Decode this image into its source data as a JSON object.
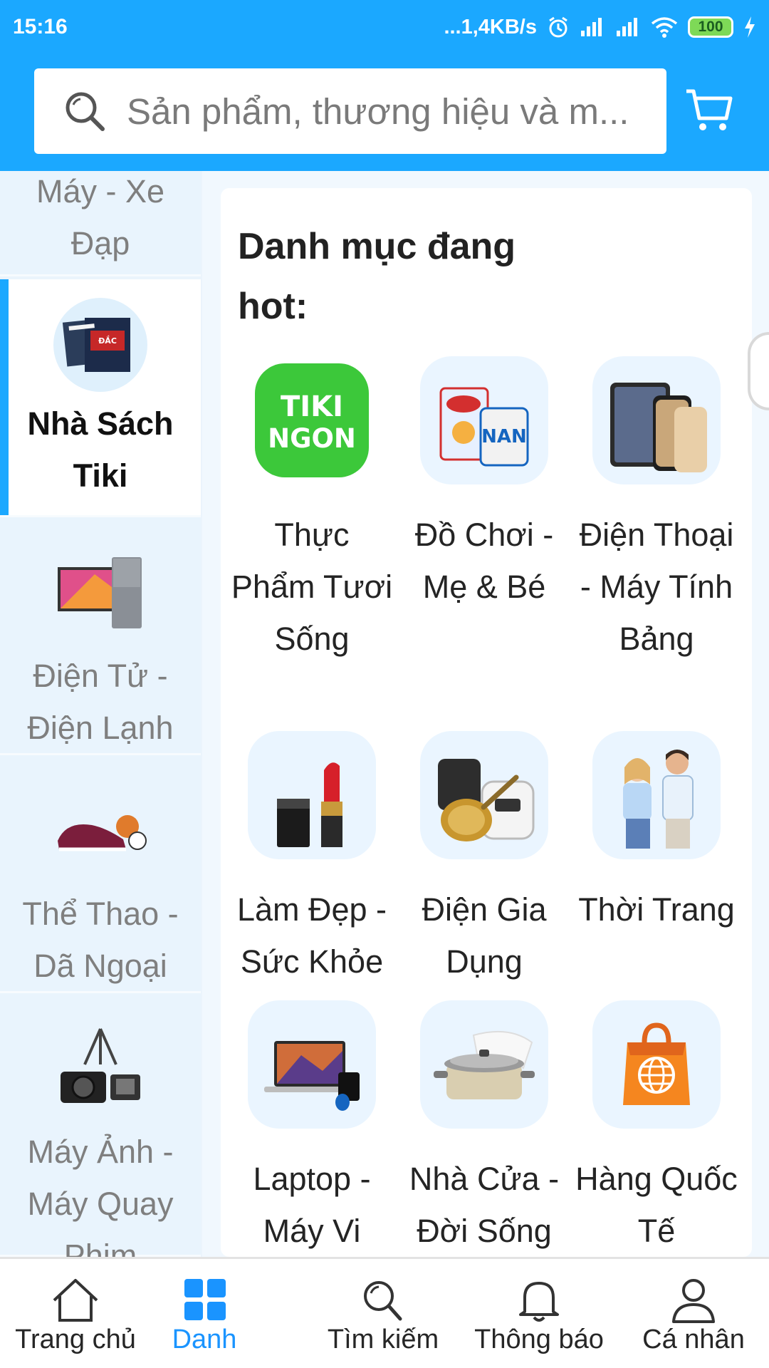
{
  "status_bar": {
    "time": "15:16",
    "speed": "...1,4KB/s",
    "battery": "100"
  },
  "search": {
    "placeholder": "Sản phẩm, thương hiệu và m..."
  },
  "sidebar": {
    "items": [
      {
        "label": "Máy - Xe Đạp",
        "icon": "bicycle-icon",
        "active": false
      },
      {
        "label": "Nhà Sách Tiki",
        "icon": "books-icon",
        "active": true
      },
      {
        "label": "Điện Tử - Điện Lạnh",
        "icon": "tv-fridge-icon",
        "active": false
      },
      {
        "label": "Thể Thao - Dã Ngoại",
        "icon": "sports-shoes-icon",
        "active": false
      },
      {
        "label": "Máy Ảnh - Máy Quay Phim",
        "icon": "camera-icon",
        "active": false
      }
    ]
  },
  "main": {
    "section_title": "Danh mục đang hot:",
    "categories": [
      {
        "label": "Thực Phẩm Tươi Sống",
        "icon": "tiki-ngon-icon",
        "logo_text_1": "TIKI",
        "logo_text_2": "NGON"
      },
      {
        "label": "Đồ Chơi - Mẹ & Bé",
        "icon": "baby-products-icon"
      },
      {
        "label": "Điện Thoại - Máy Tính Bảng",
        "icon": "phone-tablet-icon"
      },
      {
        "label": "Làm Đẹp - Sức Khỏe",
        "icon": "lipstick-icon"
      },
      {
        "label": "Điện Gia Dụng",
        "icon": "appliances-icon"
      },
      {
        "label": "Thời Trang",
        "icon": "fashion-icon"
      },
      {
        "label": "Laptop - Máy Vi",
        "icon": "laptop-icon"
      },
      {
        "label": "Nhà Cửa - Đời Sống",
        "icon": "cookware-icon"
      },
      {
        "label": "Hàng Quốc Tế",
        "icon": "global-bag-icon"
      }
    ]
  },
  "bottom_nav": {
    "items": [
      {
        "label": "Trang chủ",
        "icon": "home-icon",
        "active": false
      },
      {
        "label": "Danh",
        "icon": "grid-icon",
        "active": true
      },
      {
        "label": "Tìm kiếm",
        "icon": "search-icon",
        "active": false
      },
      {
        "label": "Thông báo",
        "icon": "bell-icon",
        "active": false
      },
      {
        "label": "Cá nhân",
        "icon": "person-icon",
        "active": false
      }
    ]
  },
  "colors": {
    "brand_blue": "#1ba8ff",
    "active_nav": "#1a94ff",
    "sidebar_bg": "#ebf4fc"
  }
}
